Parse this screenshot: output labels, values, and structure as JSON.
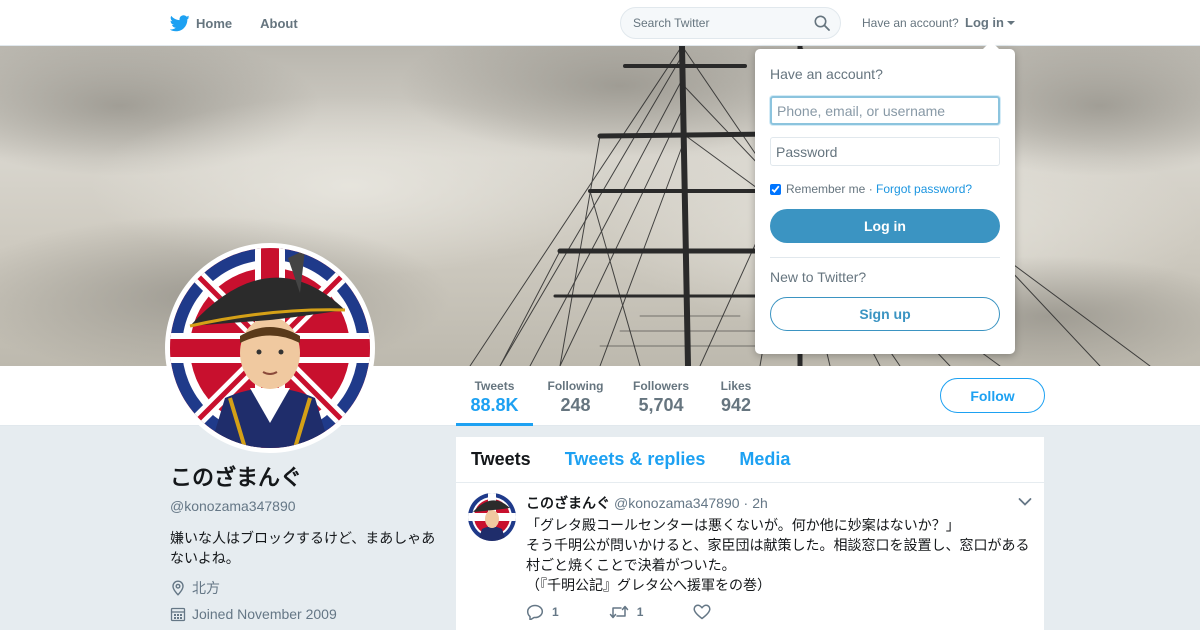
{
  "nav": {
    "home_label": "Home",
    "about_label": "About",
    "search_placeholder": "Search Twitter",
    "have_account": "Have an account?",
    "login_label": "Log in"
  },
  "profile_nav": {
    "stats": [
      {
        "label": "Tweets",
        "value": "88.8K"
      },
      {
        "label": "Following",
        "value": "248"
      },
      {
        "label": "Followers",
        "value": "5,704"
      },
      {
        "label": "Likes",
        "value": "942"
      }
    ],
    "follow_label": "Follow"
  },
  "profile": {
    "name": "このざまんぐ",
    "handle": "@konozama347890",
    "bio": "嫌いな人はブロックするけど、まあしゃあないよね。",
    "location": "北方",
    "joined": "Joined November 2009"
  },
  "timeline": {
    "tabs": [
      "Tweets",
      "Tweets & replies",
      "Media"
    ],
    "tweet": {
      "name": "このざまんぐ",
      "handle": "@konozama347890",
      "dot": "·",
      "time": "2h",
      "lines": [
        "「グレタ殿コールセンターは悪くないが。何か他に妙案はないか？」",
        "そう千明公が問いかけると、家臣団は献策した。相談窓口を設置し、窓口がある",
        "村ごと焼くことで決着がついた。",
        "（『千明公記』グレタ公へ援軍をの巻）"
      ],
      "replies": "1",
      "retweets": "1"
    }
  },
  "login_dropdown": {
    "title": "Have an account?",
    "username_placeholder": "Phone, email, or username",
    "password_placeholder": "Password",
    "remember": "Remember me",
    "separator": " · ",
    "forgot": "Forgot password?",
    "login_button": "Log in",
    "new_to": "New to Twitter?",
    "signup_button": "Sign up"
  },
  "colors": {
    "accent": "#1da1f2",
    "login_button": "#3b94c2",
    "text_muted": "#66757f",
    "background": "#e6ecf0"
  },
  "icons": [
    "twitter-bird-icon",
    "search-icon",
    "location-pin-icon",
    "calendar-icon",
    "chevron-down-icon",
    "reply-icon",
    "retweet-icon",
    "heart-icon"
  ]
}
